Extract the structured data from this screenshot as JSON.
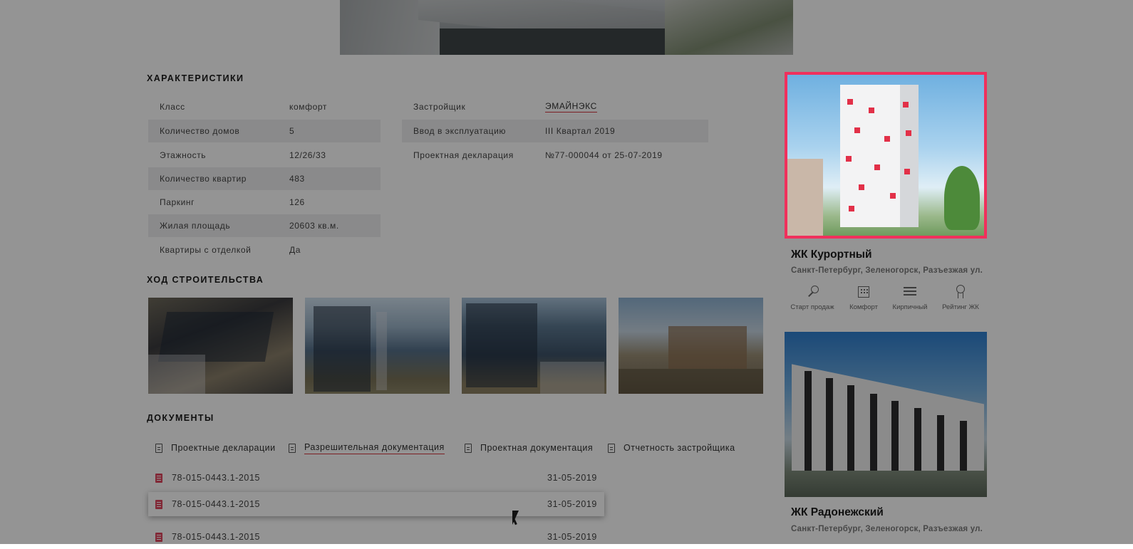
{
  "sections": {
    "characteristics": "ХАРАКТЕРИСТИКИ",
    "construction": "ХОД СТРОИТЕЛЬСТВА",
    "documents": "ДОКУМЕНТЫ"
  },
  "characteristics_left": [
    {
      "label": "Класс",
      "value": "комфорт"
    },
    {
      "label": "Количество домов",
      "value": "5"
    },
    {
      "label": "Этажность",
      "value": "12/26/33"
    },
    {
      "label": "Количество квартир",
      "value": "483"
    },
    {
      "label": "Паркинг",
      "value": "126"
    },
    {
      "label": "Жилая площадь",
      "value": "20603 кв.м."
    },
    {
      "label": "Квартиры с отделкой",
      "value": "Да"
    }
  ],
  "characteristics_right": [
    {
      "label": "Застройщик",
      "value": "ЭМАЙНЭКС"
    },
    {
      "label": "Ввод в эксплуатацию",
      "value": "III Квартал 2019"
    },
    {
      "label": "Проектная декларация",
      "value": "№77-000044 от 25-07-2019"
    }
  ],
  "document_tabs": [
    {
      "label": "Проектные декларации"
    },
    {
      "label": "Разрешительная документация"
    },
    {
      "label": "Проектная документация"
    },
    {
      "label": "Отчетность застройщика"
    }
  ],
  "documents": [
    {
      "name": "78-015-0443.1-2015",
      "date": "31-05-2019"
    },
    {
      "name": "78-015-0443.1-2015",
      "date": "31-05-2019"
    },
    {
      "name": "78-015-0443.1-2015",
      "date": "31-05-2019"
    }
  ],
  "cards": [
    {
      "title": "ЖК Курортный",
      "address": "Санкт-Петербург, Зеленогорск, Разъезжая ул.",
      "features": [
        {
          "icon": "key-icon",
          "label": "Старт продаж"
        },
        {
          "icon": "building-icon",
          "label": "Комфорт"
        },
        {
          "icon": "brick-icon",
          "label": "Кирпичный"
        },
        {
          "icon": "award-icon",
          "label": "Рейтинг ЖК"
        }
      ]
    },
    {
      "title": "ЖК Радонежский",
      "address": "Санкт-Петербург, Зеленогорск, Разъезжая ул."
    }
  ],
  "colors": {
    "accent": "#f0305c",
    "link_underline": "#d4363f"
  }
}
